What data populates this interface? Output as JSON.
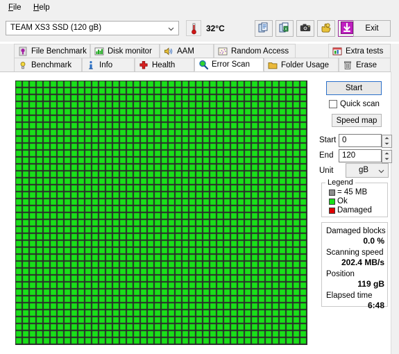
{
  "menu": {
    "items": [
      {
        "label": "File",
        "mnemonic": "F"
      },
      {
        "label": "Help",
        "mnemonic": "H"
      }
    ]
  },
  "toolbar": {
    "drive_value": "TEAM XS3 SSD (120 gB)",
    "drive_dropdown_icon": "chevron-down-icon",
    "temperature": "32°C",
    "thermometer_icon": "thermometer-icon",
    "buttons": [
      {
        "name": "copy-to-clipboard-button",
        "icon": "copy-document-icon"
      },
      {
        "name": "export-excel-button",
        "icon": "export-spreadsheet-icon"
      },
      {
        "name": "screenshot-button",
        "icon": "camera-icon"
      },
      {
        "name": "donate-button",
        "icon": "hand-coin-icon"
      },
      {
        "name": "update-button",
        "icon": "download-arrow-icon"
      }
    ],
    "exit_label": "Exit"
  },
  "tabs": {
    "row1": [
      {
        "label": "File Benchmark",
        "icon": "purple-bulb-icon",
        "selected": false
      },
      {
        "label": "Disk monitor",
        "icon": "bar-chart-icon",
        "selected": false
      },
      {
        "label": "AAM",
        "icon": "speaker-icon",
        "selected": false
      },
      {
        "label": "Random Access",
        "icon": "scatter-icon",
        "selected": false
      },
      {
        "label": "Extra tests",
        "icon": "window-chart-icon",
        "selected": false
      }
    ],
    "row2": [
      {
        "label": "Benchmark",
        "icon": "yellow-bulb-icon",
        "selected": false
      },
      {
        "label": "Info",
        "icon": "info-icon",
        "selected": false
      },
      {
        "label": "Health",
        "icon": "red-cross-icon",
        "selected": false
      },
      {
        "label": "Error Scan",
        "icon": "magnifier-icon",
        "selected": true
      },
      {
        "label": "Folder Usage",
        "icon": "folder-icon",
        "selected": false
      },
      {
        "label": "Erase",
        "icon": "trash-icon",
        "selected": false
      }
    ]
  },
  "controls": {
    "start_label": "Start",
    "quick_scan_label": "Quick scan",
    "quick_scan_checked": false,
    "speed_map_label": "Speed map",
    "start_field_label": "Start",
    "start_field_value": "0",
    "end_field_label": "End",
    "end_field_value": "120",
    "unit_label": "Unit",
    "unit_value": "gB",
    "unit_dropdown_icon": "chevron-down-icon"
  },
  "legend": {
    "caption": "Legend",
    "rows": [
      {
        "label": "= 45 MB",
        "color": "#8c8c8c"
      },
      {
        "label": "Ok",
        "color": "#19e019"
      },
      {
        "label": "Damaged",
        "color": "#e00000"
      }
    ]
  },
  "stats": [
    {
      "key": "Damaged blocks",
      "value": "0.0 %"
    },
    {
      "key": "Scanning speed",
      "value": "202.4 MB/s"
    },
    {
      "key": "Position",
      "value": "119 gB"
    },
    {
      "key": "Elapsed time",
      "value": "6:48"
    }
  ],
  "block_map": {
    "columns": 42,
    "rows": 38,
    "block_size": 10,
    "gap": 2,
    "ok_color": "#19e019",
    "grid_background": "#2b2b2b",
    "damaged_blocks": 0,
    "status": "all-ok"
  }
}
